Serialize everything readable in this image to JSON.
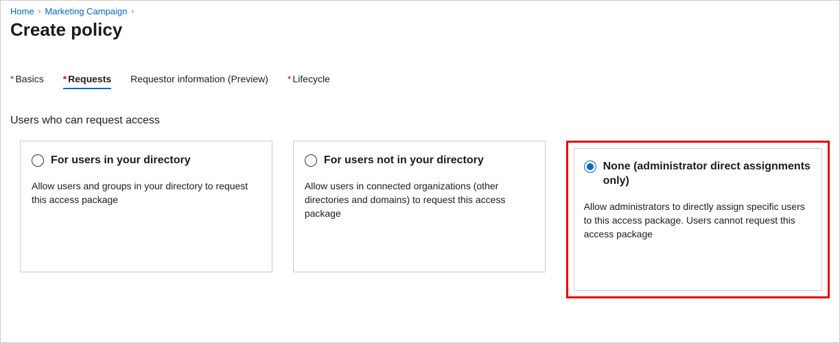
{
  "breadcrumb": {
    "home": "Home",
    "campaign": "Marketing Campaign"
  },
  "page_title": "Create policy",
  "tabs": {
    "basics": "Basics",
    "requests": "Requests",
    "requestor_info": "Requestor information (Preview)",
    "lifecycle": "Lifecycle"
  },
  "section_heading": "Users who can request access",
  "options": {
    "in_directory": {
      "title": "For users in your directory",
      "desc": "Allow users and groups in your directory to request this access package"
    },
    "not_in_directory": {
      "title": "For users not in your directory",
      "desc": "Allow users in connected organizations (other directories and domains) to request this access package"
    },
    "none": {
      "title": "None (administrator direct assignments only)",
      "desc": "Allow administrators to directly assign specific users to this access package. Users cannot request this access package"
    }
  }
}
